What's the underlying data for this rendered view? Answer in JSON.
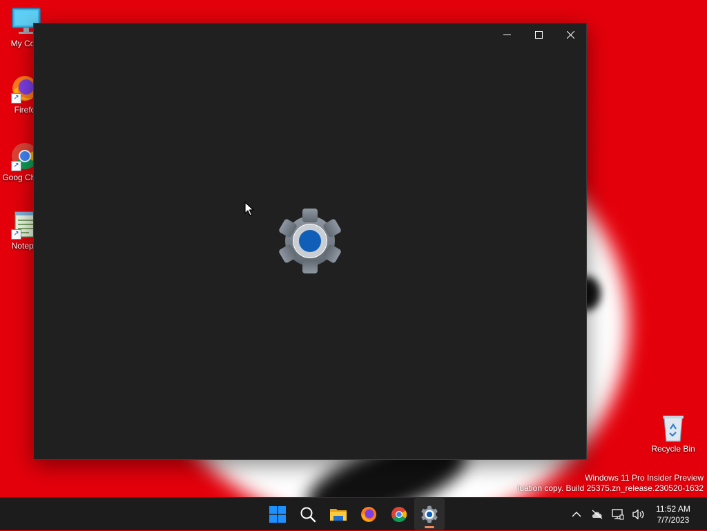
{
  "desktop": {
    "icons": [
      {
        "label": "My Com",
        "icon": "computer-icon"
      },
      {
        "label": "Firefo",
        "icon": "firefox-icon"
      },
      {
        "label": "Goog Chron",
        "icon": "chrome-icon"
      },
      {
        "label": "Notepa",
        "icon": "notepad-icon"
      },
      {
        "label": "Recycle Bin",
        "icon": "recycle-bin-icon"
      }
    ]
  },
  "window": {
    "app": "Settings",
    "splash_icon": "settings-gear-icon",
    "controls": {
      "minimize": "minimize-icon",
      "maximize": "maximize-icon",
      "close": "close-icon"
    }
  },
  "watermark": {
    "line1": "Windows 11 Pro Insider Preview",
    "line2": "luation copy. Build 25375.zn_release.230520-1632"
  },
  "taskbar": {
    "apps": [
      {
        "name": "Start",
        "icon": "windows-start-icon"
      },
      {
        "name": "Search",
        "icon": "search-icon"
      },
      {
        "name": "File Explorer",
        "icon": "folder-icon"
      },
      {
        "name": "Firefox",
        "icon": "firefox-icon"
      },
      {
        "name": "Google Chrome",
        "icon": "chrome-icon"
      },
      {
        "name": "Settings",
        "icon": "settings-gear-icon",
        "active": true
      }
    ],
    "tray": [
      "chevron-up-icon",
      "onedrive-offline-icon",
      "network-icon",
      "volume-icon"
    ],
    "clock": {
      "time": "11:52 AM",
      "date": "7/7/2023"
    }
  },
  "colors": {
    "accent": "#0f5fb8",
    "window_bg": "#202020",
    "taskbar_bg": "#1c1c1c",
    "wallpaper_red": "#e4000b"
  }
}
